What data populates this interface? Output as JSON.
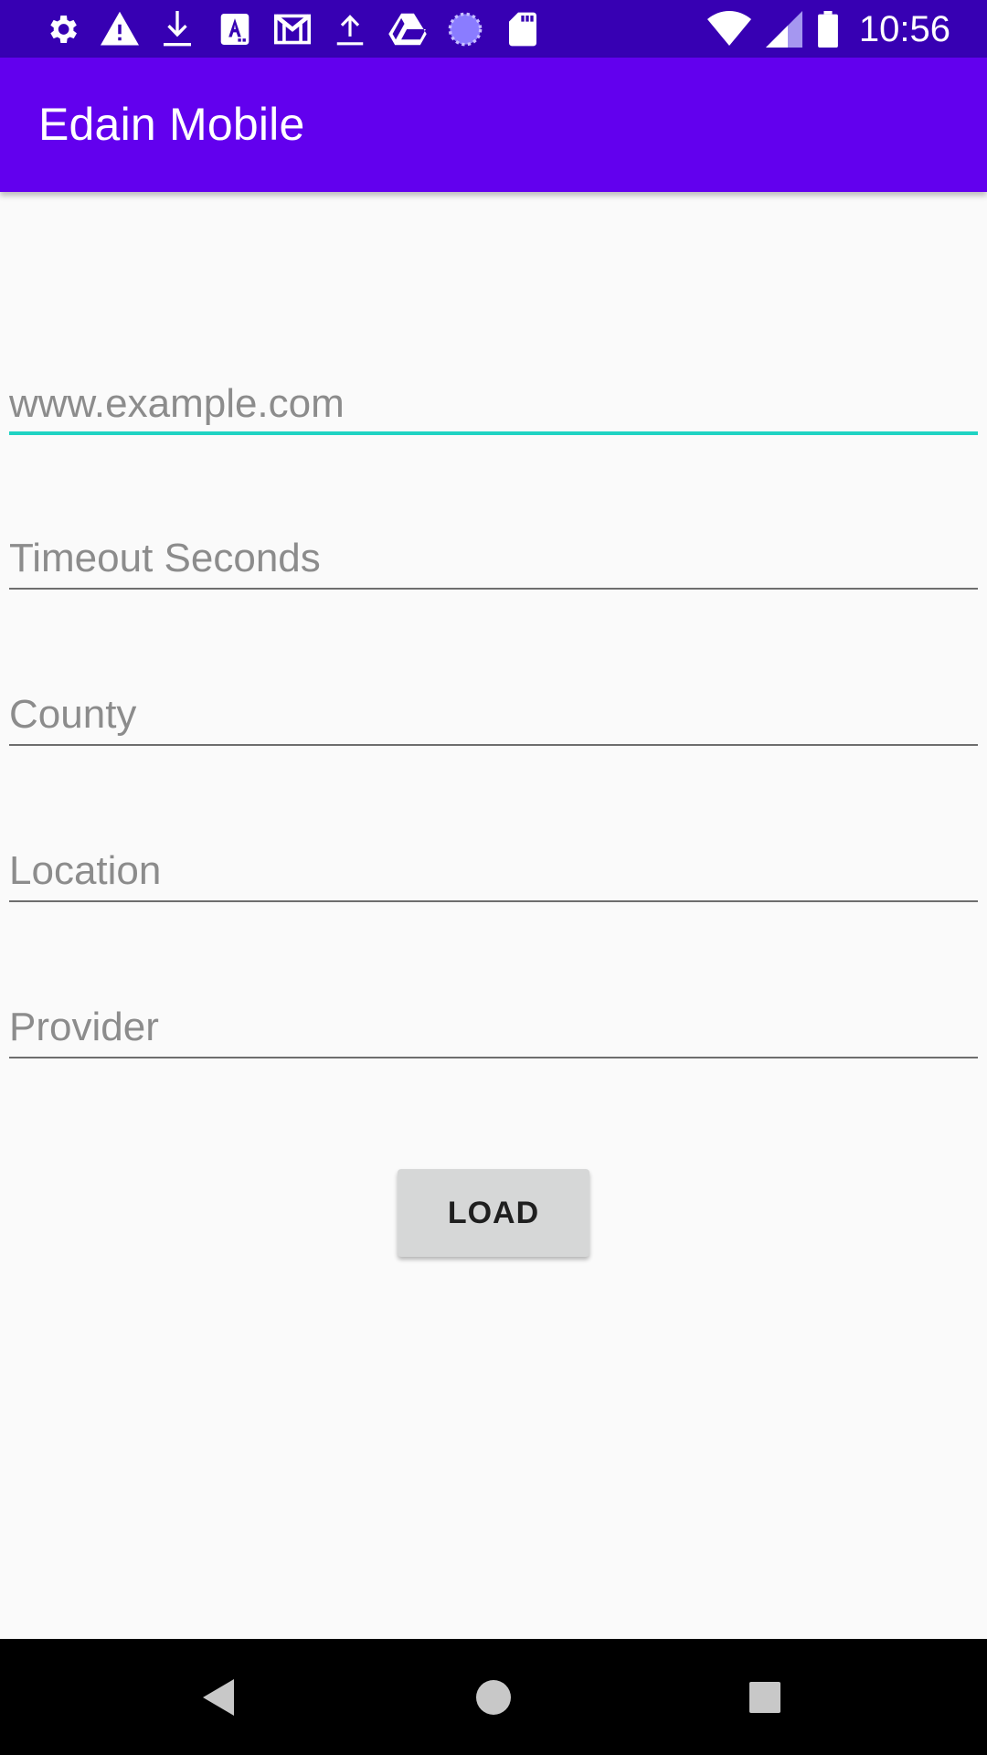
{
  "status_bar": {
    "time": "10:56",
    "left_icons": [
      "gear-icon",
      "warning-icon",
      "download-icon",
      "font-a-icon",
      "gmail-icon",
      "upload-icon",
      "drive-icon",
      "sync-circle-icon",
      "sd-card-icon"
    ],
    "right_icons": [
      "wifi-icon",
      "cell-signal-icon",
      "battery-icon"
    ]
  },
  "app_bar": {
    "title": "Edain Mobile"
  },
  "form": {
    "url": {
      "value": "",
      "placeholder": "www.example.com"
    },
    "timeout": {
      "value": "",
      "placeholder": "Timeout Seconds"
    },
    "county": {
      "value": "",
      "placeholder": "County"
    },
    "location": {
      "value": "",
      "placeholder": "Location"
    },
    "provider": {
      "value": "",
      "placeholder": "Provider"
    }
  },
  "load_button": {
    "label": "LOAD"
  },
  "nav_bar": {
    "buttons": [
      "back-icon",
      "home-icon",
      "recents-icon"
    ]
  },
  "colors": {
    "status_bar": "#3700b3",
    "app_bar": "#6200ee",
    "accent": "#1fd3c3",
    "background": "#fafafa",
    "button": "#d6d7d7"
  }
}
